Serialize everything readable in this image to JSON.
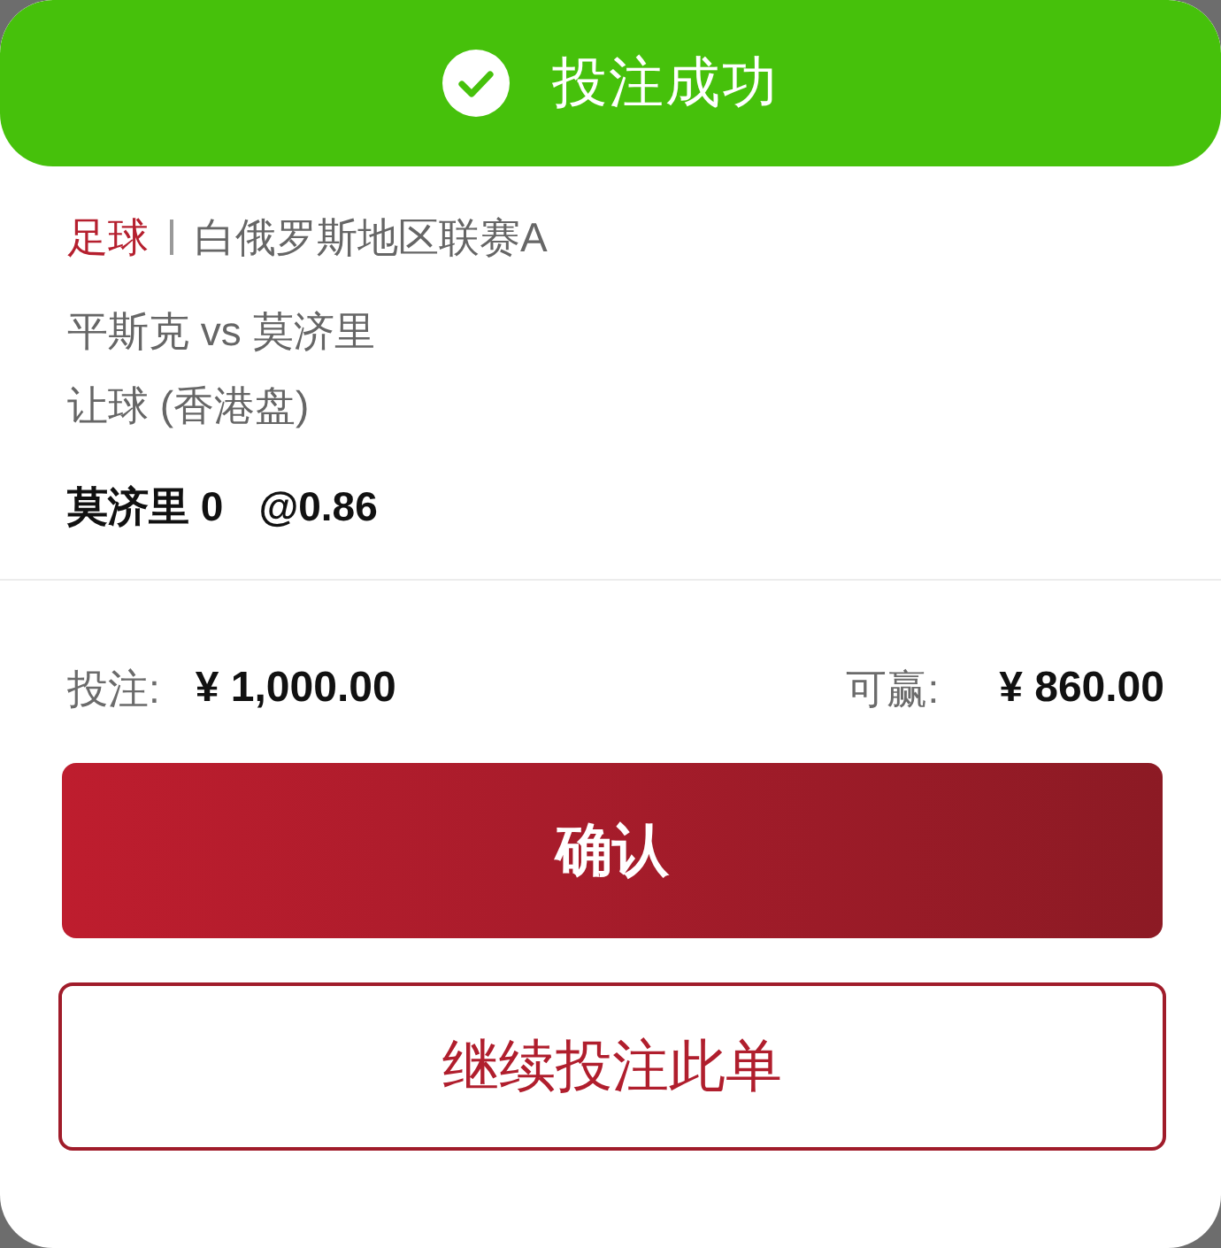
{
  "header": {
    "title": "投注成功"
  },
  "bet": {
    "sport": "足球",
    "league": "白俄罗斯地区联赛A",
    "match": "平斯克 vs 莫济里",
    "market": "让球 (香港盘)",
    "selection": "莫济里 0",
    "odds": "@0.86"
  },
  "summary": [
    {
      "label": "投注:",
      "value": "¥ 1,000.00"
    },
    {
      "label": "可赢:",
      "value": "¥ 860.00"
    }
  ],
  "buttons": [
    {
      "label": "确认",
      "kind": "primary"
    },
    {
      "label": "继续投注此单",
      "kind": "outline"
    }
  ]
}
